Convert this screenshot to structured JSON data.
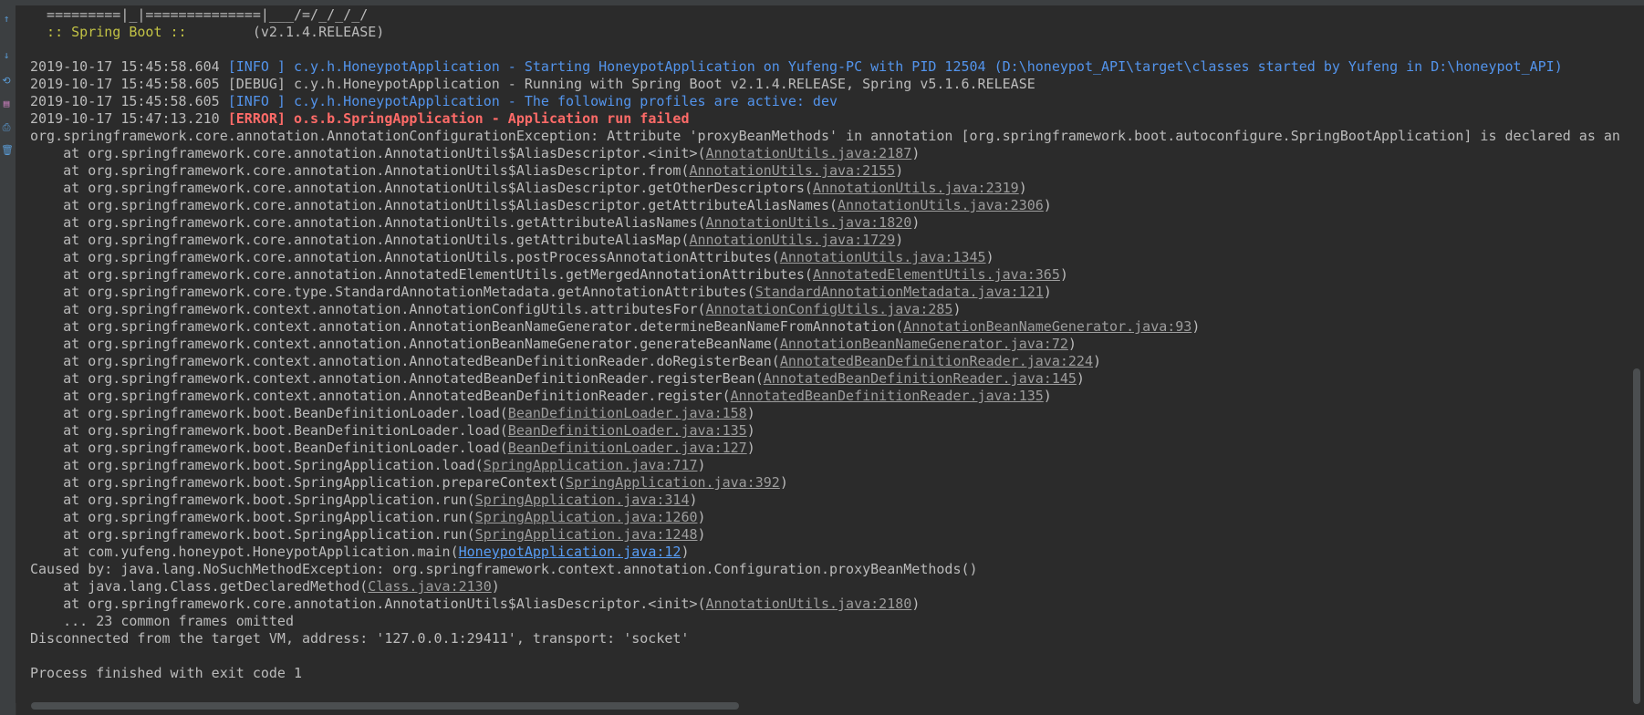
{
  "gutter_icons": [
    "arrow-up-icon",
    "arrow-down-icon",
    "soft-wrap-icon",
    "scroll-to-end-icon",
    "print-icon",
    "trash-icon"
  ],
  "colors": {
    "background": "#2b2b2b",
    "info": "#5394ec",
    "error": "#ff6b68",
    "default": "#bbbbbb",
    "spring_banner": "#c2c245",
    "link": "#9d9d9d"
  },
  "console": {
    "lines": [
      {
        "segs": [
          {
            "t": "  =========|_|==============|___/=/_/_/_/",
            "c": "banner"
          }
        ]
      },
      {
        "segs": [
          {
            "t": "  :: Spring Boot :: ",
            "c": "spring"
          },
          {
            "t": "       (v2.1.4.RELEASE)",
            "c": "banner"
          }
        ]
      },
      {
        "segs": [
          {
            "t": "",
            "c": ""
          }
        ]
      },
      {
        "segs": [
          {
            "t": "2019-10-17 15:45:58.604 ",
            "c": ""
          },
          {
            "t": "[INFO ] c.y.h.HoneypotApplication - Starting HoneypotApplication on Yufeng-PC with PID 12504 (D:\\honeypot_API\\target\\classes started by Yufeng in D:\\honeypot_API)",
            "c": "info"
          }
        ]
      },
      {
        "segs": [
          {
            "t": "2019-10-17 15:45:58.605 ",
            "c": ""
          },
          {
            "t": "[DEBUG] c.y.h.HoneypotApplication - Running with Spring Boot v2.1.4.RELEASE, Spring v5.1.6.RELEASE",
            "c": "debug"
          }
        ]
      },
      {
        "segs": [
          {
            "t": "2019-10-17 15:45:58.605 ",
            "c": ""
          },
          {
            "t": "[INFO ] c.y.h.HoneypotApplication - The following profiles are active: dev",
            "c": "info"
          }
        ]
      },
      {
        "segs": [
          {
            "t": "2019-10-17 15:47:13.210 ",
            "c": ""
          },
          {
            "t": "[ERROR] o.s.b.SpringApplication - Application run failed",
            "c": "err"
          }
        ]
      },
      {
        "segs": [
          {
            "t": "org.springframework.core.annotation.AnnotationConfigurationException: Attribute 'proxyBeanMethods' in annotation [org.springframework.boot.autoconfigure.SpringBootApplication] is declared as an @AliasFor",
            "c": ""
          }
        ]
      },
      {
        "segs": [
          {
            "t": "    at org.springframework.core.annotation.AnnotationUtils$AliasDescriptor.<init>(",
            "c": ""
          },
          {
            "t": "AnnotationUtils.java:2187",
            "c": "link"
          },
          {
            "t": ")",
            "c": ""
          }
        ]
      },
      {
        "segs": [
          {
            "t": "    at org.springframework.core.annotation.AnnotationUtils$AliasDescriptor.from(",
            "c": ""
          },
          {
            "t": "AnnotationUtils.java:2155",
            "c": "link"
          },
          {
            "t": ")",
            "c": ""
          }
        ]
      },
      {
        "segs": [
          {
            "t": "    at org.springframework.core.annotation.AnnotationUtils$AliasDescriptor.getOtherDescriptors(",
            "c": ""
          },
          {
            "t": "AnnotationUtils.java:2319",
            "c": "link"
          },
          {
            "t": ")",
            "c": ""
          }
        ]
      },
      {
        "segs": [
          {
            "t": "    at org.springframework.core.annotation.AnnotationUtils$AliasDescriptor.getAttributeAliasNames(",
            "c": ""
          },
          {
            "t": "AnnotationUtils.java:2306",
            "c": "link"
          },
          {
            "t": ")",
            "c": ""
          }
        ]
      },
      {
        "segs": [
          {
            "t": "    at org.springframework.core.annotation.AnnotationUtils.getAttributeAliasNames(",
            "c": ""
          },
          {
            "t": "AnnotationUtils.java:1820",
            "c": "link"
          },
          {
            "t": ")",
            "c": ""
          }
        ]
      },
      {
        "segs": [
          {
            "t": "    at org.springframework.core.annotation.AnnotationUtils.getAttributeAliasMap(",
            "c": ""
          },
          {
            "t": "AnnotationUtils.java:1729",
            "c": "link"
          },
          {
            "t": ")",
            "c": ""
          }
        ]
      },
      {
        "segs": [
          {
            "t": "    at org.springframework.core.annotation.AnnotationUtils.postProcessAnnotationAttributes(",
            "c": ""
          },
          {
            "t": "AnnotationUtils.java:1345",
            "c": "link"
          },
          {
            "t": ")",
            "c": ""
          }
        ]
      },
      {
        "segs": [
          {
            "t": "    at org.springframework.core.annotation.AnnotatedElementUtils.getMergedAnnotationAttributes(",
            "c": ""
          },
          {
            "t": "AnnotatedElementUtils.java:365",
            "c": "link"
          },
          {
            "t": ")",
            "c": ""
          }
        ]
      },
      {
        "segs": [
          {
            "t": "    at org.springframework.core.type.StandardAnnotationMetadata.getAnnotationAttributes(",
            "c": ""
          },
          {
            "t": "StandardAnnotationMetadata.java:121",
            "c": "link"
          },
          {
            "t": ")",
            "c": ""
          }
        ]
      },
      {
        "segs": [
          {
            "t": "    at org.springframework.context.annotation.AnnotationConfigUtils.attributesFor(",
            "c": ""
          },
          {
            "t": "AnnotationConfigUtils.java:285",
            "c": "link"
          },
          {
            "t": ")",
            "c": ""
          }
        ]
      },
      {
        "segs": [
          {
            "t": "    at org.springframework.context.annotation.AnnotationBeanNameGenerator.determineBeanNameFromAnnotation(",
            "c": ""
          },
          {
            "t": "AnnotationBeanNameGenerator.java:93",
            "c": "link"
          },
          {
            "t": ")",
            "c": ""
          }
        ]
      },
      {
        "segs": [
          {
            "t": "    at org.springframework.context.annotation.AnnotationBeanNameGenerator.generateBeanName(",
            "c": ""
          },
          {
            "t": "AnnotationBeanNameGenerator.java:72",
            "c": "link"
          },
          {
            "t": ")",
            "c": ""
          }
        ]
      },
      {
        "segs": [
          {
            "t": "    at org.springframework.context.annotation.AnnotatedBeanDefinitionReader.doRegisterBean(",
            "c": ""
          },
          {
            "t": "AnnotatedBeanDefinitionReader.java:224",
            "c": "link"
          },
          {
            "t": ")",
            "c": ""
          }
        ]
      },
      {
        "segs": [
          {
            "t": "    at org.springframework.context.annotation.AnnotatedBeanDefinitionReader.registerBean(",
            "c": ""
          },
          {
            "t": "AnnotatedBeanDefinitionReader.java:145",
            "c": "link"
          },
          {
            "t": ")",
            "c": ""
          }
        ]
      },
      {
        "segs": [
          {
            "t": "    at org.springframework.context.annotation.AnnotatedBeanDefinitionReader.register(",
            "c": ""
          },
          {
            "t": "AnnotatedBeanDefinitionReader.java:135",
            "c": "link"
          },
          {
            "t": ")",
            "c": ""
          }
        ]
      },
      {
        "segs": [
          {
            "t": "    at org.springframework.boot.BeanDefinitionLoader.load(",
            "c": ""
          },
          {
            "t": "BeanDefinitionLoader.java:158",
            "c": "link"
          },
          {
            "t": ")",
            "c": ""
          }
        ]
      },
      {
        "segs": [
          {
            "t": "    at org.springframework.boot.BeanDefinitionLoader.load(",
            "c": ""
          },
          {
            "t": "BeanDefinitionLoader.java:135",
            "c": "link"
          },
          {
            "t": ")",
            "c": ""
          }
        ]
      },
      {
        "segs": [
          {
            "t": "    at org.springframework.boot.BeanDefinitionLoader.load(",
            "c": ""
          },
          {
            "t": "BeanDefinitionLoader.java:127",
            "c": "link"
          },
          {
            "t": ")",
            "c": ""
          }
        ]
      },
      {
        "segs": [
          {
            "t": "    at org.springframework.boot.SpringApplication.load(",
            "c": ""
          },
          {
            "t": "SpringApplication.java:717",
            "c": "link"
          },
          {
            "t": ")",
            "c": ""
          }
        ]
      },
      {
        "segs": [
          {
            "t": "    at org.springframework.boot.SpringApplication.prepareContext(",
            "c": ""
          },
          {
            "t": "SpringApplication.java:392",
            "c": "link"
          },
          {
            "t": ")",
            "c": ""
          }
        ]
      },
      {
        "segs": [
          {
            "t": "    at org.springframework.boot.SpringApplication.run(",
            "c": ""
          },
          {
            "t": "SpringApplication.java:314",
            "c": "link"
          },
          {
            "t": ")",
            "c": ""
          }
        ]
      },
      {
        "segs": [
          {
            "t": "    at org.springframework.boot.SpringApplication.run(",
            "c": ""
          },
          {
            "t": "SpringApplication.java:1260",
            "c": "link"
          },
          {
            "t": ")",
            "c": ""
          }
        ]
      },
      {
        "segs": [
          {
            "t": "    at org.springframework.boot.SpringApplication.run(",
            "c": ""
          },
          {
            "t": "SpringApplication.java:1248",
            "c": "link"
          },
          {
            "t": ")",
            "c": ""
          }
        ]
      },
      {
        "segs": [
          {
            "t": "    at com.yufeng.honeypot.HoneypotApplication.main(",
            "c": ""
          },
          {
            "t": "HoneypotApplication.java:12",
            "c": "link user"
          },
          {
            "t": ")",
            "c": ""
          }
        ]
      },
      {
        "segs": [
          {
            "t": "Caused by: java.lang.NoSuchMethodException: org.springframework.context.annotation.Configuration.proxyBeanMethods()",
            "c": ""
          }
        ]
      },
      {
        "segs": [
          {
            "t": "    at java.lang.Class.getDeclaredMethod(",
            "c": ""
          },
          {
            "t": "Class.java:2130",
            "c": "link"
          },
          {
            "t": ")",
            "c": ""
          }
        ]
      },
      {
        "segs": [
          {
            "t": "    at org.springframework.core.annotation.AnnotationUtils$AliasDescriptor.<init>(",
            "c": ""
          },
          {
            "t": "AnnotationUtils.java:2180",
            "c": "link"
          },
          {
            "t": ")",
            "c": ""
          }
        ]
      },
      {
        "segs": [
          {
            "t": "    ... 23 common frames omitted",
            "c": ""
          }
        ]
      },
      {
        "segs": [
          {
            "t": "Disconnected from the target VM, address: '127.0.0.1:29411', transport: 'socket'",
            "c": ""
          }
        ]
      },
      {
        "segs": [
          {
            "t": "",
            "c": ""
          }
        ]
      },
      {
        "segs": [
          {
            "t": "Process finished with exit code 1",
            "c": ""
          }
        ]
      }
    ]
  }
}
